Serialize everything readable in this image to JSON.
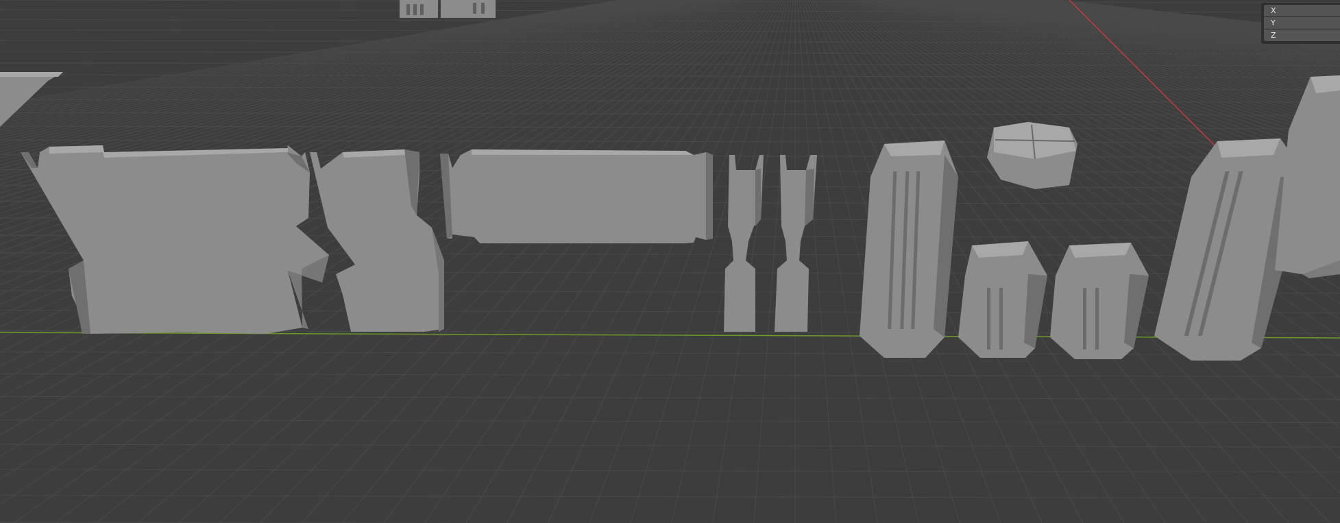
{
  "colors": {
    "viewport_bg": "#3d3d3d",
    "grid_line": "#4a4a4a",
    "axis_x_line": "#c93a3a",
    "axis_y_line": "#6e9a2a",
    "mesh_fill": "#8c8c8c",
    "mesh_shade": "#6f6f6f",
    "mesh_light": "#a8a8a8"
  },
  "axis_panel": {
    "x_label": "X",
    "y_label": "Y",
    "z_label": "Z"
  }
}
